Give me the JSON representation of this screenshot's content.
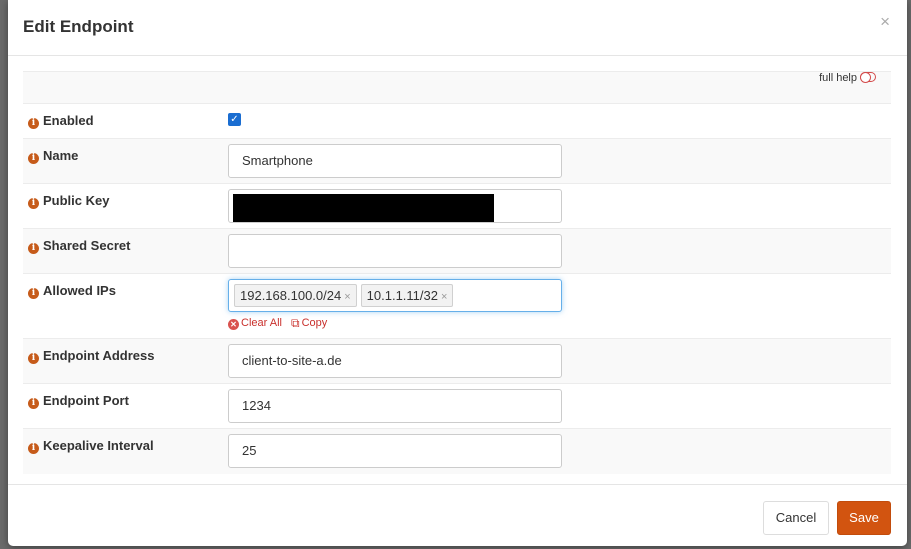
{
  "modal": {
    "title": "Edit Endpoint",
    "close_label": "×",
    "full_help_label": "full help",
    "fields": {
      "enabled": {
        "label": "Enabled",
        "checked": true,
        "check_glyph": "✓"
      },
      "name": {
        "label": "Name",
        "value": "Smartphone"
      },
      "public_key": {
        "label": "Public Key",
        "value": ""
      },
      "shared_secret": {
        "label": "Shared Secret",
        "value": ""
      },
      "allowed_ips": {
        "label": "Allowed IPs",
        "tags": [
          "192.168.100.0/24",
          "10.1.1.11/32"
        ],
        "remove_glyph": "×",
        "clear_all_label": "Clear All",
        "copy_label": "Copy"
      },
      "endpoint_address": {
        "label": "Endpoint Address",
        "value": "client-to-site-a.de"
      },
      "endpoint_port": {
        "label": "Endpoint Port",
        "value": "1234"
      },
      "keepalive_interval": {
        "label": "Keepalive Interval",
        "value": "25"
      }
    },
    "info_glyph": "i",
    "footer": {
      "cancel_label": "Cancel",
      "save_label": "Save"
    }
  },
  "colors": {
    "accent": "#d25410",
    "info_icon": "#c65b1a",
    "link_red": "#c9302c",
    "checkbox": "#1a6dd1"
  }
}
